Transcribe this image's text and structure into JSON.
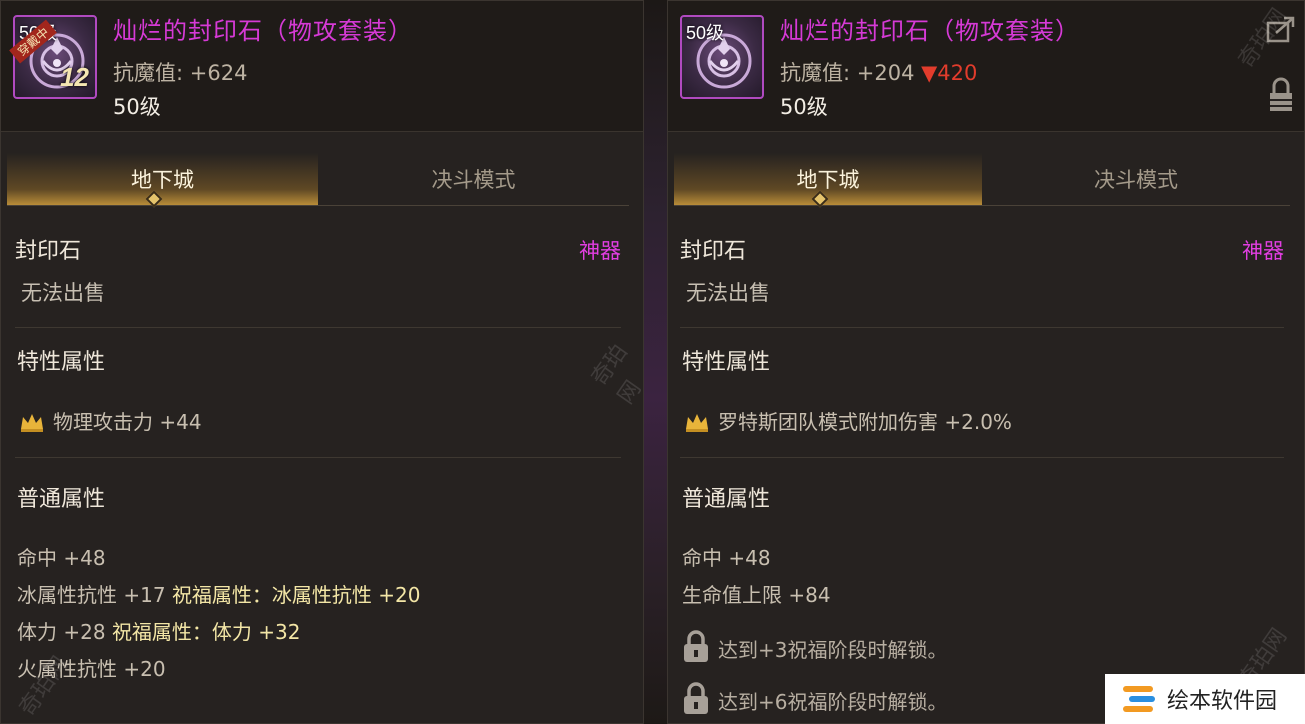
{
  "left": {
    "icon_level": "50级",
    "equipped_badge": "穿戴中",
    "enhance": "12",
    "title": "灿烂的封印石（物攻套装）",
    "resist_label": "抗魔值:",
    "resist_value": "+624",
    "level": "50级",
    "tabs": [
      "地下城",
      "决斗模式"
    ],
    "category": "封印石",
    "grade": "神器",
    "sell": "无法出售",
    "special_title": "特性属性",
    "special_attr": "物理攻击力 +44",
    "normal_title": "普通属性",
    "attrs": [
      {
        "base": "命中 +48",
        "bless": ""
      },
      {
        "base": "冰属性抗性 +17",
        "bless": "祝福属性：冰属性抗性 +20"
      },
      {
        "base": "体力 +28",
        "bless": "祝福属性：体力 +32"
      },
      {
        "base": "火属性抗性 +20",
        "bless": ""
      }
    ]
  },
  "right": {
    "icon_level": "50级",
    "title": "灿烂的封印石（物攻套装）",
    "resist_label": "抗魔值:",
    "resist_value": "+204",
    "resist_diff": "▼420",
    "level": "50级",
    "tabs": [
      "地下城",
      "决斗模式"
    ],
    "category": "封印石",
    "grade": "神器",
    "sell": "无法出售",
    "special_title": "特性属性",
    "special_attr": "罗特斯团队模式附加伤害 +2.0%",
    "normal_title": "普通属性",
    "attrs": [
      "命中 +48",
      "生命值上限 +84"
    ],
    "locks": [
      "达到+3祝福阶段时解锁。",
      "达到+6祝福阶段时解锁。"
    ]
  },
  "watermark": "奇珀网",
  "logo_text": "绘本软件园",
  "colors": {
    "item_name": "#d63ad6",
    "grade": "#e23ee2",
    "decrease": "#e23c2c",
    "bless": "#f3e6a6",
    "tab_active": "#b88c38"
  },
  "icons": [
    "seal-emblem-icon",
    "crown-icon",
    "lock-icon",
    "share-icon",
    "padlock-icon"
  ]
}
